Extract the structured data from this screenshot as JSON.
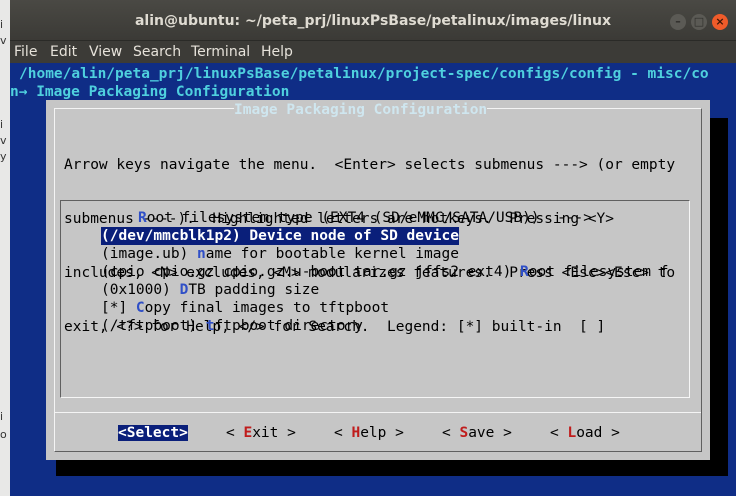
{
  "background_window": {
    "letters": [
      "i",
      "v",
      "i",
      "v",
      "y",
      "i",
      "o"
    ]
  },
  "window": {
    "title": "alin@ubuntu: ~/peta_prj/linuxPsBase/petalinux/images/linux",
    "buttons": [
      "–",
      "□",
      "×"
    ]
  },
  "menubar": [
    "File",
    "Edit",
    "View",
    "Search",
    "Terminal",
    "Help"
  ],
  "terminal": {
    "config_path": "/home/alin/peta_prj/linuxPsBase/petalinux/project-spec/configs/config - misc/co",
    "breadcrumb": "n→ Image Packaging Configuration"
  },
  "dialog": {
    "title": "Image Packaging Configuration",
    "help_lines": [
      "Arrow keys navigate the menu.  <Enter> selects submenus ---> (or empty",
      "submenus ----).  Highlighted letters are hotkeys.  Pressing <Y>",
      "includes, <N> excludes, <M> modularizes features.  Press <Esc><Esc> to",
      "exit, <?> for Help, </> for Search.  Legend: [*] built-in  [ ]"
    ],
    "items": [
      {
        "pre": "",
        "hk": "R",
        "post": "oot filesystem type (EXT4 (SD/eMMC/SATA/USB))  --->",
        "selected": false
      },
      {
        "pre": "(/dev/mmcblk1p2) ",
        "hk": "D",
        "post": "evice node of SD device",
        "selected": true
      },
      {
        "pre": "(image.ub) ",
        "hk": "n",
        "post": "ame for bootable kernel image",
        "selected": false
      },
      {
        "pre": "(cpio cpio.gz cpio.gz.u-boot tar.gz jffs2 ext4) ",
        "hk": "R",
        "post": "oot filesystem f",
        "selected": false
      },
      {
        "pre": "(0x1000) ",
        "hk": "D",
        "post": "TB padding size",
        "selected": false
      },
      {
        "pre": "[*] ",
        "hk": "C",
        "post": "opy final images to tftpboot",
        "selected": false
      },
      {
        "pre": "(/tftpboot) ",
        "hk": "t",
        "post": "ftpboot directory",
        "selected": false
      }
    ],
    "buttons": [
      {
        "pre": "<",
        "hk": "S",
        "post": "elect>",
        "active": true
      },
      {
        "pre": "< ",
        "hk": "E",
        "post": "xit >",
        "active": false
      },
      {
        "pre": "< ",
        "hk": "H",
        "post": "elp >",
        "active": false
      },
      {
        "pre": "< ",
        "hk": "S",
        "post": "ave >",
        "active": false
      },
      {
        "pre": "< ",
        "hk": "L",
        "post": "oad >",
        "active": false
      }
    ]
  }
}
